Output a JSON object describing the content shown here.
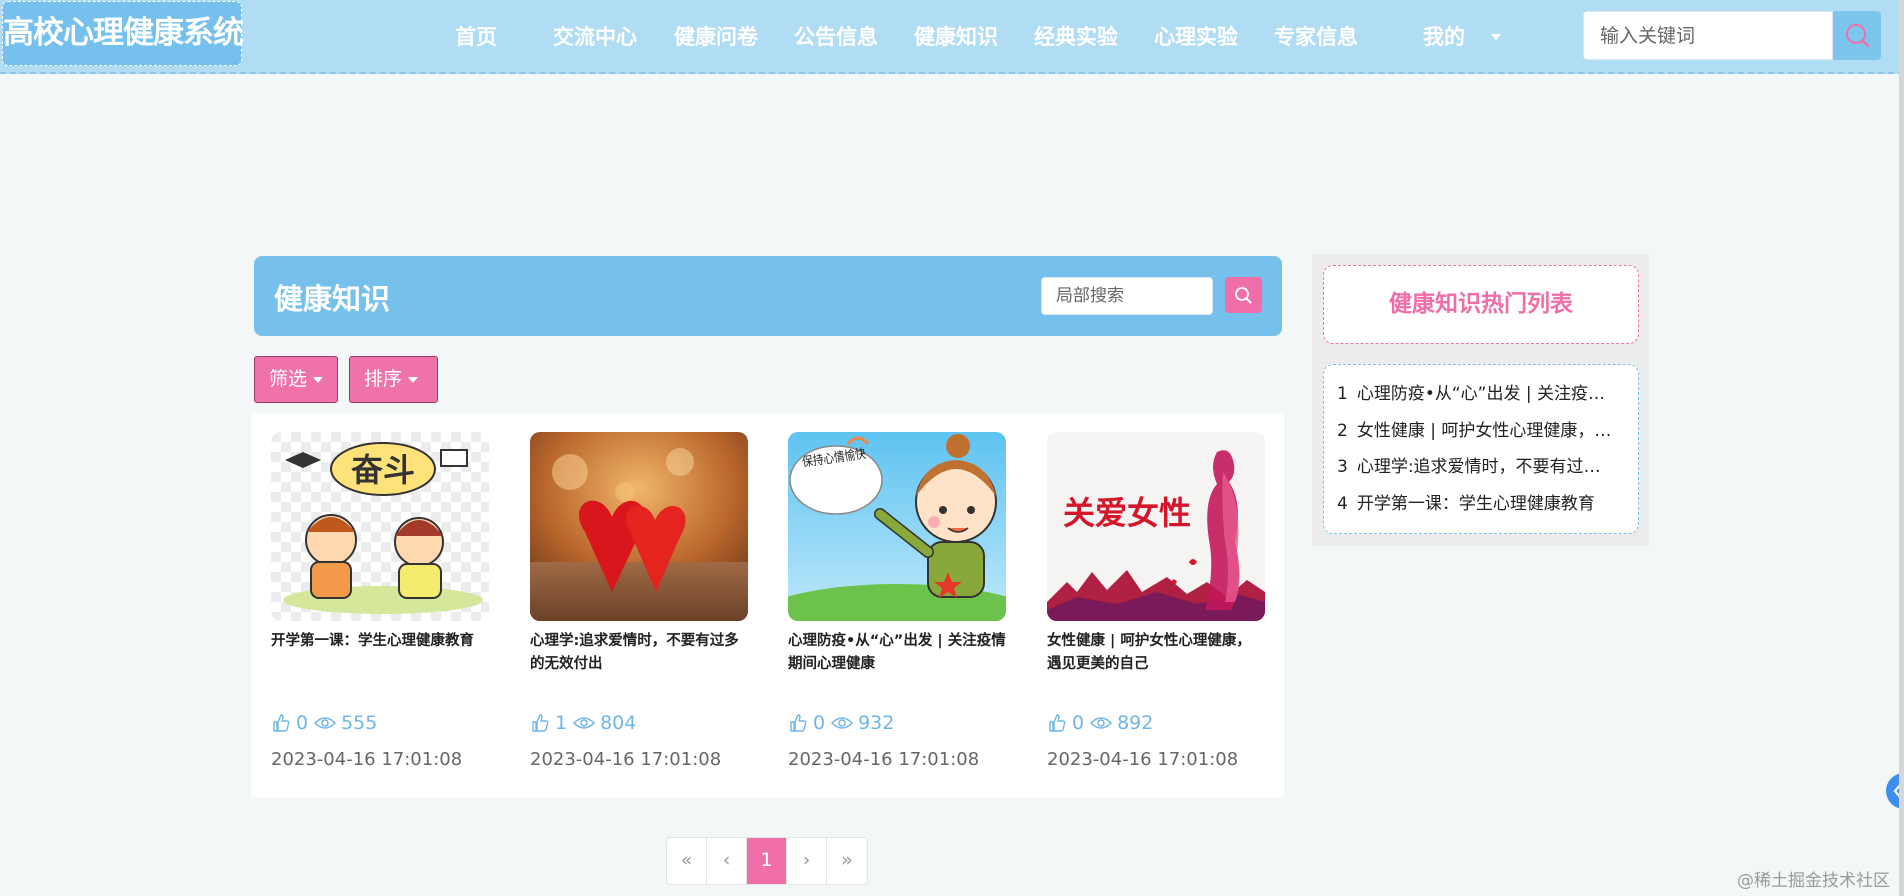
{
  "app": {
    "title": "高校心理健康系统"
  },
  "nav": {
    "items": [
      {
        "label": "首页"
      },
      {
        "label": "交流中心"
      },
      {
        "label": "健康问卷"
      },
      {
        "label": "公告信息"
      },
      {
        "label": "健康知识"
      },
      {
        "label": "经典实验"
      },
      {
        "label": "心理实验"
      },
      {
        "label": "专家信息"
      },
      {
        "label": "我的"
      }
    ],
    "search_placeholder": "输入关键词",
    "search_icon": "search-icon"
  },
  "section": {
    "title": "健康知识",
    "search_placeholder": "局部搜索"
  },
  "filters": {
    "filter_label": "筛选",
    "sort_label": "排序"
  },
  "cards": [
    {
      "title": "开学第一课：学生心理健康教育",
      "likes": "0",
      "views": "555",
      "date": "2023-04-16 17:01:08",
      "image": "cartoon-students-fendou"
    },
    {
      "title": "心理学:追求爱情时，不要有过多的无效付出",
      "likes": "1",
      "views": "804",
      "date": "2023-04-16 17:01:08",
      "image": "two-red-hearts"
    },
    {
      "title": "心理防疫•从“心”出发 | 关注疫情期间心理健康",
      "likes": "0",
      "views": "932",
      "date": "2023-04-16 17:01:08",
      "image": "cartoon-girl-keep-happy"
    },
    {
      "title": "女性健康 | 呵护女性心理健康，遇见更美的自己",
      "likes": "0",
      "views": "892",
      "date": "2023-04-16 17:01:08",
      "image": "care-for-women-banner"
    }
  ],
  "images": {
    "fendou": "奋斗",
    "keep_happy": "保持心情愉快",
    "care_women": "关爱女性"
  },
  "pagination": {
    "first": "«",
    "prev": "‹",
    "current": "1",
    "next": "›",
    "last": "»"
  },
  "hot": {
    "title": "健康知识热门列表",
    "items": [
      {
        "num": "1",
        "text": "心理防疫•从“心”出发 | 关注疫情期间心理健康"
      },
      {
        "num": "2",
        "text": "女性健康 | 呵护女性心理健康，遇见更美的自己"
      },
      {
        "num": "3",
        "text": "心理学:追求爱情时，不要有过多的无效付出"
      },
      {
        "num": "4",
        "text": "开学第一课：学生心理健康教育"
      }
    ]
  },
  "watermark": "@稀土掘金技术社区",
  "colors": {
    "nav_bg": "#b0ddf3",
    "accent_blue": "#76c1ec",
    "accent_pink": "#f06fa9",
    "page_bg": "#f4f7f7"
  }
}
